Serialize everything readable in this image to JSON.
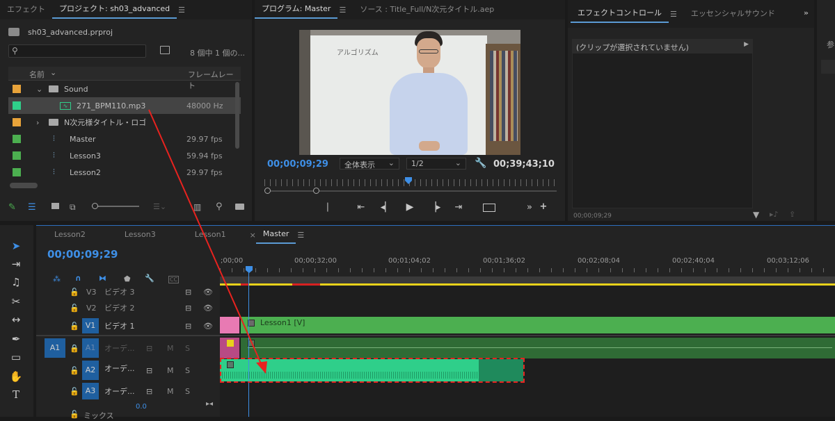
{
  "project_panel": {
    "tab_effects": "エフェクト",
    "tab_project": "プロジェクト: sh03_advanced",
    "project_file": "sh03_advanced.prproj",
    "item_count": "8 個中 1 個の...",
    "col_name": "名前",
    "col_fps": "フレームレート",
    "items": [
      {
        "name": "Sound",
        "rate": "",
        "color": "#e8a33a",
        "kind": "folder-open"
      },
      {
        "name": "271_BPM110.mp3",
        "rate": "48000 Hz",
        "color": "#2fcf8a",
        "kind": "audio"
      },
      {
        "name": "N次元様タイトル・ロゴ",
        "rate": "",
        "color": "#e8a33a",
        "kind": "folder"
      },
      {
        "name": "Master",
        "rate": "29.97 fps",
        "color": "#4caf50",
        "kind": "sequence"
      },
      {
        "name": "Lesson3",
        "rate": "59.94 fps",
        "color": "#4caf50",
        "kind": "sequence"
      },
      {
        "name": "Lesson2",
        "rate": "29.97 fps",
        "color": "#4caf50",
        "kind": "sequence"
      }
    ]
  },
  "program_panel": {
    "tab_program": "プログラム: Master",
    "tab_source": "ソース : Title_Full/N次元タイトル.aep",
    "timecode": "00;00;09;29",
    "zoom_select": "全体表示",
    "resolution_select": "1/2",
    "duration": "00;39;43;10",
    "whiteboard_text": "アルゴリズム"
  },
  "effect_controls": {
    "tab_effect_controls": "エフェクトコントロール",
    "tab_essential_sound": "エッセンシャルサウンド",
    "no_clip": "(クリップが選択されていません)",
    "timecode": "00;00;09;29",
    "right_panel_label": "参"
  },
  "timeline": {
    "tabs": [
      "Lesson2",
      "Lesson3",
      "Lesson1",
      "Master"
    ],
    "timecode": "00;00;09;29",
    "ruler": [
      ";00;00",
      "00;00;32;00",
      "00;01;04;02",
      "00;01;36;02",
      "00;02;08;04",
      "00;02;40;04",
      "00;03;12;06"
    ],
    "tracks": [
      {
        "id": "V3",
        "name": "ビデオ 3"
      },
      {
        "id": "V2",
        "name": "ビデオ 2"
      },
      {
        "id": "V1",
        "name": "ビデオ 1"
      },
      {
        "id": "A1",
        "name": "オーデ..."
      },
      {
        "id": "A2",
        "name": "オーデ..."
      },
      {
        "id": "A3",
        "name": "オーデ..."
      }
    ],
    "source_patch": "A1",
    "mute_label": "M",
    "solo_label": "S",
    "mix_label": "ミックス",
    "mix_value": "0.0",
    "clip_v1": "Lesson1 [V]",
    "cc_label": "CC"
  },
  "colors": {
    "accent_blue": "#3e8fe6",
    "clip_green": "#4caf50",
    "audio_green": "#2fcf8a",
    "clip_pink": "#e87ab3",
    "annotation_red": "#e8231f"
  }
}
